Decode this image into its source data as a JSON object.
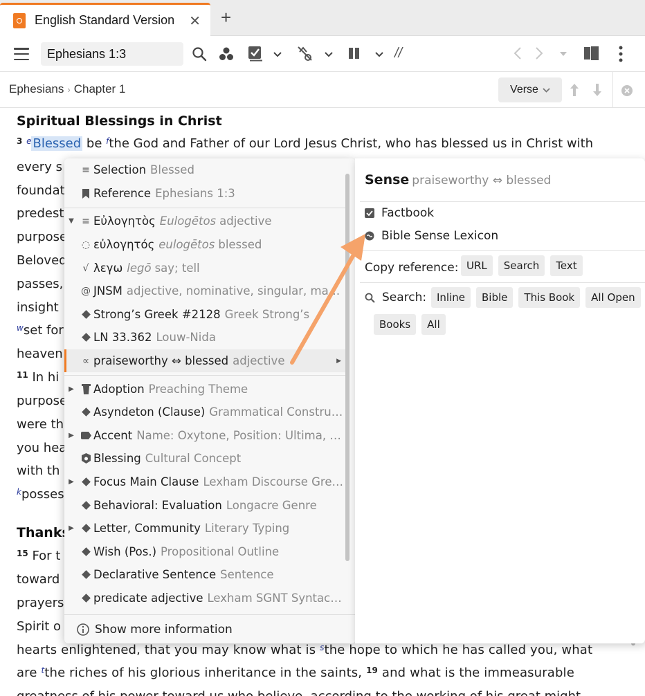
{
  "tab": {
    "title": "English Standard Version",
    "close": "✕",
    "new_tab": "+"
  },
  "toolbar": {
    "reference_value": "Ephesians 1:3",
    "parallel_marks": "//"
  },
  "breadcrumb": {
    "book": "Ephesians",
    "separator": "›",
    "chapter": "Chapter 1",
    "mode_label": "Verse"
  },
  "reader": {
    "heading1": "Spiritual Blessings in Christ",
    "verse3_num": "3",
    "fn_e": "e",
    "selected_word": "Blessed",
    "verse3_a": " be ",
    "fn_f": "f",
    "verse3_b": "the God and Father of our Lord Jesus Christ, who has blessed us in Christ with",
    "lines_left": [
      "every s",
      "foundat",
      "predest",
      "purpose",
      "Beloved",
      "passes,",
      "insight",
      "",
      "heaven"
    ],
    "line_w_fn": "w",
    "line_w_text": "set for",
    "line11_num": "11",
    "line11_text": "In hi",
    "lines_left2": [
      "purpose",
      "were th",
      "you hea",
      "with th"
    ],
    "line_k_fn": "k",
    "line_k_text": "possess",
    "heading2": "Thanks",
    "verse15_num": "15",
    "verse15_text": "For t",
    "lines_left3": [
      "toward",
      "prayers",
      "Spirit o"
    ],
    "line_hearts_a": "hearts enlightened, that you may know what is ",
    "fn_s": "s",
    "line_hearts_b": "the hope to which he has called you, what",
    "line_are_a": "are ",
    "fn_t": "t",
    "line_are_b": "the riches of his glorious inheritance in the saints, ",
    "verse19_num": "19",
    "line_are_c": " and what is the immeasurable",
    "line_last": "greatness of his power toward us who believe, according to the working of his great might"
  },
  "menu": {
    "items": [
      {
        "main": "Selection",
        "sub": "Blessed"
      },
      {
        "main": "Reference",
        "sub": "Ephesians 1:3"
      },
      {
        "main": "Εὐλογητὸς",
        "sub_it": "Eulogētos",
        "sub": "adjective"
      },
      {
        "main": "εὐλογητός",
        "sub_it": "eulogētos",
        "sub": "blessed"
      },
      {
        "main": "λεγω",
        "sub_it": "legō",
        "sub": "say; tell"
      },
      {
        "main": "JNSM",
        "sub": "adjective, nominative, singular, masc…"
      },
      {
        "main": "Strong’s Greek #2128",
        "sub": "Greek Strong’s"
      },
      {
        "main": "LN 33.362",
        "sub": "Louw-Nida"
      },
      {
        "main": "praiseworthy ⇔ blessed",
        "sub": "adjective"
      },
      {
        "main": "Adoption",
        "sub": "Preaching Theme"
      },
      {
        "main": "Asyndeton (Clause)",
        "sub": "Grammatical Constructi…"
      },
      {
        "main": "Accent",
        "sub": "Name: Oxytone, Position: Ultima, Ty…"
      },
      {
        "main": "Blessing",
        "sub": "Cultural Concept"
      },
      {
        "main": "Focus Main Clause",
        "sub": "Lexham Discourse Greek…"
      },
      {
        "main": "Behavioral: Evaluation",
        "sub": "Longacre Genre"
      },
      {
        "main": "Letter, Community",
        "sub": "Literary Typing"
      },
      {
        "main": "Wish (Pos.)",
        "sub": "Propositional Outline"
      },
      {
        "main": "Declarative Sentence",
        "sub": "Sentence"
      },
      {
        "main": "predicate adjective",
        "sub": "Lexham SGNT Syntactic…"
      }
    ],
    "footer": "Show more information"
  },
  "panel": {
    "title": "Sense",
    "title_sub": "praiseworthy ⇔ blessed",
    "factbook": "Factbook",
    "lexicon": "Bible Sense Lexicon",
    "copy_label": "Copy reference:",
    "copy_chips": [
      "URL",
      "Search",
      "Text"
    ],
    "search_label": "Search:",
    "search_chips": [
      "Inline",
      "Bible",
      "This Book",
      "All Open",
      "Books",
      "All"
    ]
  },
  "colors": {
    "accent": "#f07a22",
    "footnote": "#2a3a9a",
    "selection": "#d7e5f7",
    "arrow": "#f5a36a"
  }
}
